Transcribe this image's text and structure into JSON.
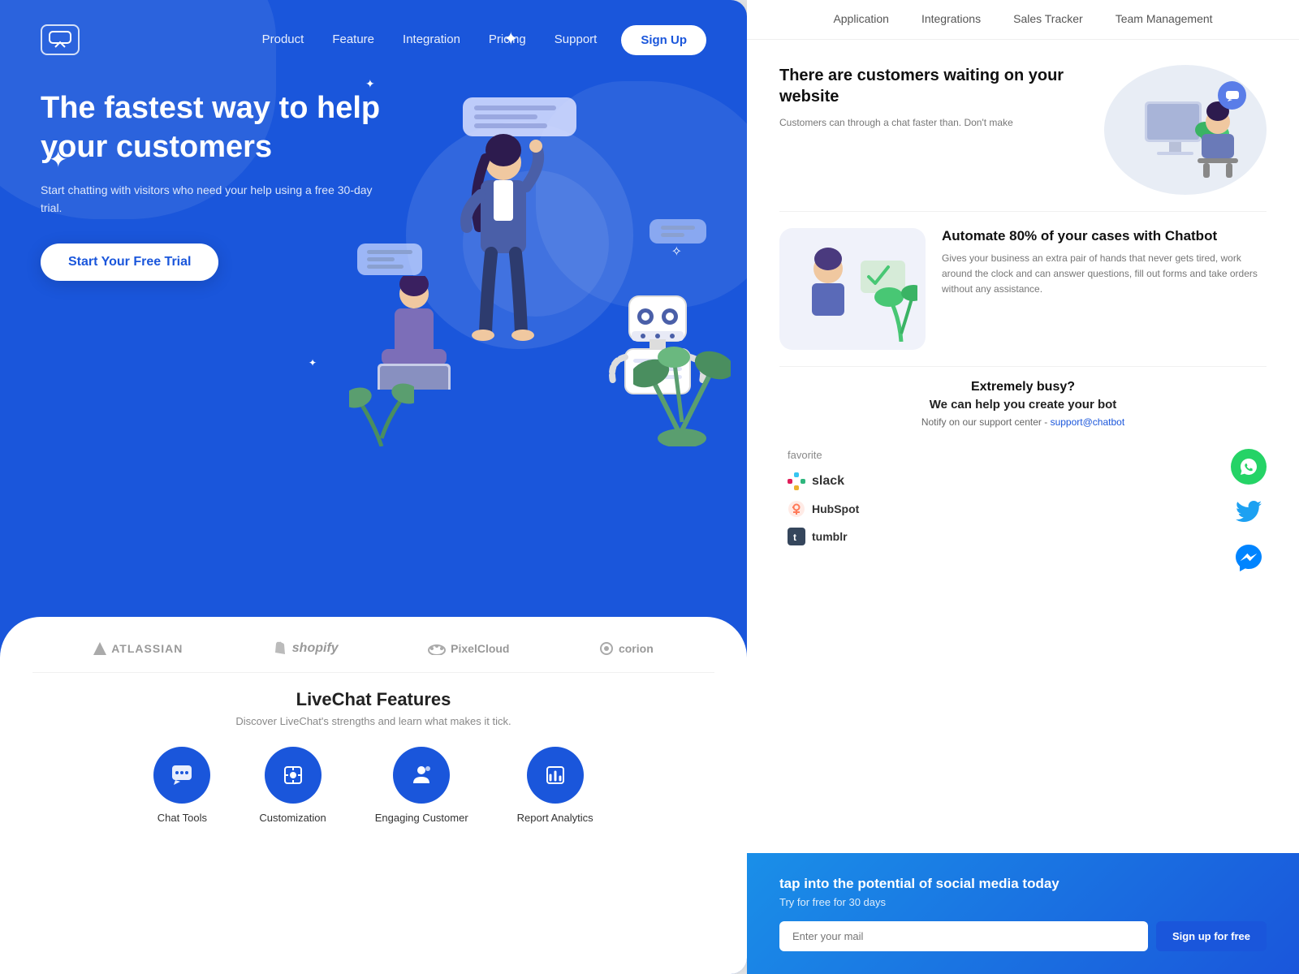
{
  "leftPanel": {
    "nav": {
      "logoAlt": "LiveChat Logo",
      "links": [
        "Product",
        "Feature",
        "Integration",
        "Pricing",
        "Support"
      ],
      "signupLabel": "Sign Up"
    },
    "hero": {
      "heading": "The fastest way to help your customers",
      "subtext": "Start chatting with visitors who need your help using a free 30-day trial.",
      "ctaLabel": "Start Your Free Trial"
    },
    "brands": [
      {
        "name": "ATLASSIAN",
        "icon": "▲"
      },
      {
        "name": "shopify",
        "icon": "🛍"
      },
      {
        "name": "PixelCloud",
        "icon": "☁"
      },
      {
        "name": "corion",
        "icon": "⚙"
      }
    ],
    "features": {
      "title": "LiveChat Features",
      "subtitle": "Discover LiveChat's strengths and learn what makes it tick.",
      "items": [
        {
          "icon": "💬",
          "label": "Chat Tools"
        },
        {
          "icon": "⚙",
          "label": "Customization"
        },
        {
          "icon": "👤",
          "label": "Engaging Customer"
        },
        {
          "icon": "📊",
          "label": "Report Analytics"
        }
      ]
    }
  },
  "rightPanel": {
    "nav": {
      "links": [
        "Application",
        "Integrations",
        "Sales Tracker",
        "Team Management"
      ]
    },
    "customerSection": {
      "heading": "There are customers waiting on your website",
      "body": "Customers can through a chat faster than. Don't make"
    },
    "chatbotSection": {
      "heading": "Automate 80% of your cases with Chatbot",
      "body": "Gives your business an extra pair of hands that never gets tired, work around the clock and can answer questions, fill out forms and take orders without any assistance."
    },
    "busySection": {
      "heading": "Extremely busy?",
      "subheading": "We can help you create your bot",
      "body": "Notify on our support center - ",
      "link": "support@chatbot"
    },
    "favoriteLabel": "favorite",
    "integrations": {
      "slack": "slack",
      "whatsapp": "WhatsApp",
      "twitter": "Twitter",
      "messenger": "Messenger",
      "hubspot": "HubSpot",
      "tumblr": "tumblr"
    },
    "socialSection": {
      "heading": "tap into the potential of social media today",
      "subtext": "Try for free for 30 days",
      "inputPlaceholder": "Enter your mail",
      "btnLabel": "Sign up for free"
    }
  }
}
